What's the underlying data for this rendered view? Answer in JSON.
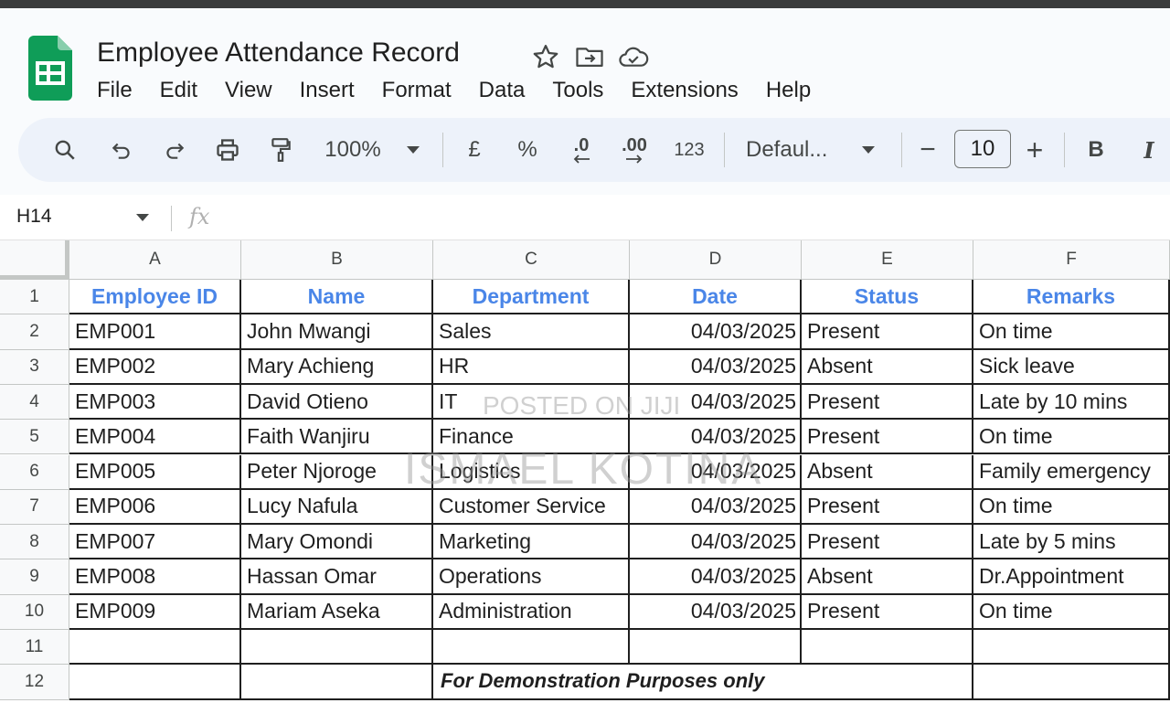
{
  "app": {
    "title": "Employee Attendance Record",
    "menu": [
      "File",
      "Edit",
      "View",
      "Insert",
      "Format",
      "Data",
      "Tools",
      "Extensions",
      "Help"
    ]
  },
  "toolbar": {
    "zoom": "100%",
    "currency": "£",
    "percent": "%",
    "decrease_decimal": ".0",
    "increase_decimal": ".00",
    "number_format": "123",
    "font": "Defaul...",
    "font_size": "10",
    "minus": "−",
    "plus": "+",
    "bold": "B",
    "italic": "I",
    "icons": [
      "search-icon",
      "undo-icon",
      "redo-icon",
      "print-icon",
      "paint-format-icon",
      "chevron-down-icon"
    ]
  },
  "formula_bar": {
    "name_box": "H14",
    "fx_label": "fx",
    "content": ""
  },
  "sheet": {
    "columns": [
      "A",
      "B",
      "C",
      "D",
      "E",
      "F"
    ],
    "rows": [
      "1",
      "2",
      "3",
      "4",
      "5",
      "6",
      "7",
      "8",
      "9",
      "10",
      "11",
      "12"
    ],
    "header": [
      "Employee ID",
      "Name",
      "Department",
      "Date",
      "Status",
      "Remarks"
    ],
    "data": [
      [
        "EMP001",
        "John Mwangi",
        "Sales",
        "04/03/2025",
        "Present",
        "On time"
      ],
      [
        "EMP002",
        "Mary Achieng",
        "HR",
        "04/03/2025",
        "Absent",
        "Sick leave"
      ],
      [
        "EMP003",
        "David Otieno",
        "IT",
        "04/03/2025",
        "Present",
        "Late by 10 mins"
      ],
      [
        "EMP004",
        "Faith Wanjiru",
        "Finance",
        "04/03/2025",
        "Present",
        "On time"
      ],
      [
        "EMP005",
        "Peter Njoroge",
        "Logistics",
        "04/03/2025",
        "Absent",
        "Family emergency"
      ],
      [
        "EMP006",
        "Lucy Nafula",
        "Customer Service",
        "04/03/2025",
        "Present",
        "On time"
      ],
      [
        "EMP007",
        "Mary Omondi",
        "Marketing",
        "04/03/2025",
        "Present",
        "Late by 5 mins"
      ],
      [
        "EMP008",
        "Hassan Omar",
        "Operations",
        "04/03/2025",
        "Absent",
        "Dr.Appointment"
      ],
      [
        "EMP009",
        "Mariam Aseka",
        "Administration",
        "04/03/2025",
        "Present",
        "On time"
      ]
    ],
    "note": "For  Demonstration Purposes only"
  },
  "watermark": {
    "line1": "POSTED ON JIJI",
    "line2": "ISMAEL KOTINA"
  },
  "colors": {
    "header_text": "#4a86e8",
    "logo_green": "#0f9d58"
  }
}
